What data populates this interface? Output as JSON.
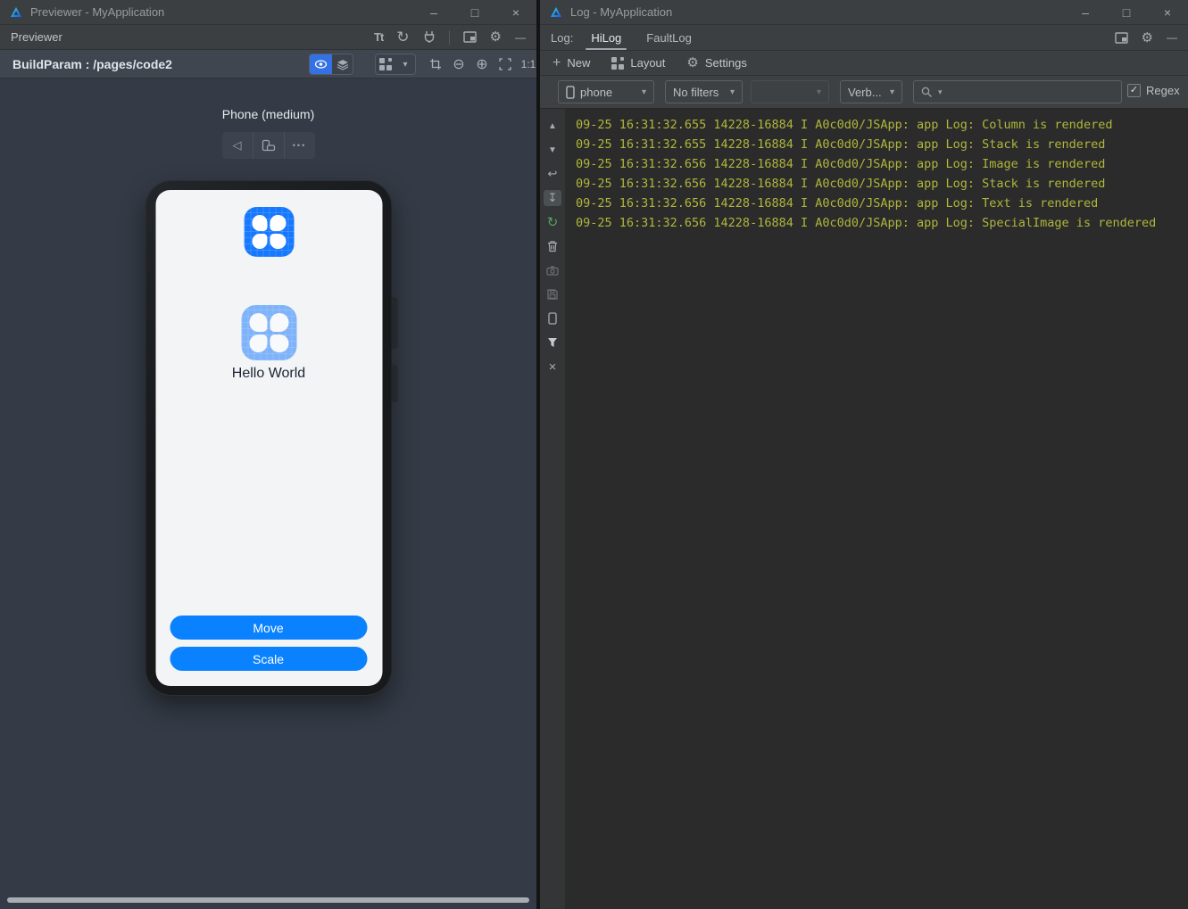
{
  "icons": {
    "text_size": "Tt",
    "refresh": "↻",
    "gear": "⚙",
    "hide": "—",
    "minimize": "–",
    "maximize": "□",
    "close": "×",
    "caret_down": "▾",
    "zoom_out": "⊖",
    "zoom_in": "⊕",
    "back": "◁",
    "more": "•••",
    "plus": "+",
    "check": "✓",
    "up": "▲",
    "down": "▼",
    "soft_wrap": "↩",
    "scroll_end": "↧",
    "restart": "↻",
    "close_small": "×"
  },
  "left_window": {
    "title": "Previewer - MyApplication",
    "panel_title": "Previewer",
    "build_param": "BuildParam : /pages/code2",
    "zoom_ratio": "1:1",
    "device_label": "Phone (medium)",
    "screen": {
      "app_label": "Hello World",
      "move_button": "Move",
      "scale_button": "Scale"
    }
  },
  "right_window": {
    "title": "Log - MyApplication",
    "log_label": "Log:",
    "tabs": {
      "hilog": "HiLog",
      "faultlog": "FaultLog"
    },
    "toolbar": {
      "new_label": "New",
      "layout_label": "Layout",
      "settings_label": "Settings"
    },
    "filters": {
      "device_value": "phone",
      "filter_value": "No filters",
      "empty_value": "",
      "level_value": "Verb...",
      "search_value": "",
      "regex_label": "Regex"
    },
    "log_lines": [
      "09-25 16:31:32.655 14228-16884 I A0c0d0/JSApp: app Log: Column is rendered",
      "09-25 16:31:32.655 14228-16884 I A0c0d0/JSApp: app Log: Stack is rendered",
      "09-25 16:31:32.656 14228-16884 I A0c0d0/JSApp: app Log: Image is rendered",
      "09-25 16:31:32.656 14228-16884 I A0c0d0/JSApp: app Log: Stack is rendered",
      "09-25 16:31:32.656 14228-16884 I A0c0d0/JSApp: app Log: Text is rendered",
      "09-25 16:31:32.656 14228-16884 I A0c0d0/JSApp: app Log: SpecialImage is rendered"
    ]
  },
  "colors": {
    "accent_blue": "#0A82FF",
    "app_icon_blue": "#1678FF",
    "log_text": "#B0B63B",
    "selected_tool_blue": "#3472E4",
    "canvas_bg": "#343B46",
    "log_bg": "#2B2B2B"
  }
}
